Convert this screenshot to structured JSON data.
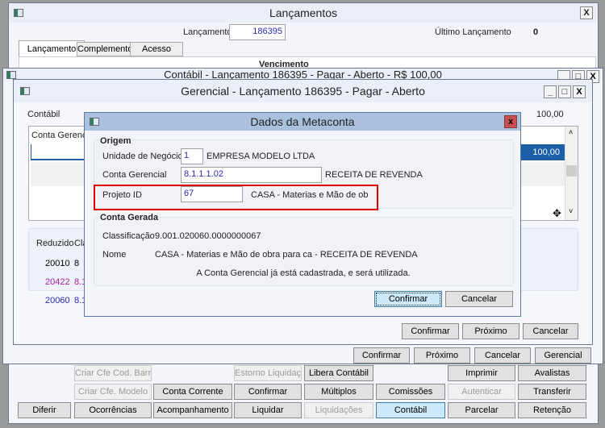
{
  "main": {
    "title": "Lançamentos",
    "lancamento_label": "Lançamento",
    "lancamento_value": "186395",
    "ultimo_label": "Último Lançamento",
    "ultimo_value": "0",
    "tabs": [
      {
        "label": "Lançamento"
      },
      {
        "label": "Complemento"
      },
      {
        "label": "Acesso"
      }
    ],
    "vencimento": "Vencimento",
    "buttons": [
      {
        "label": "Criar Cfe Cod. Barras",
        "disabled": true
      },
      {
        "label": "Estorno Liquidação",
        "disabled": true
      },
      {
        "label": "Libera Contábil"
      },
      {
        "label": "Imprimir"
      },
      {
        "label": "Avalistas"
      },
      {
        "label": "Criar Cfe. Modelo",
        "disabled": true
      },
      {
        "label": "Conta Corrente"
      },
      {
        "label": "Confirmar"
      },
      {
        "label": "Múltiplos"
      },
      {
        "label": "Comissões"
      },
      {
        "label": "Autenticar",
        "disabled": true
      },
      {
        "label": "Transferir"
      },
      {
        "label": "Diferir"
      },
      {
        "label": "Ocorrências"
      },
      {
        "label": "Acompanhamento"
      },
      {
        "label": "Liquidar"
      },
      {
        "label": "Liquidações",
        "disabled": true
      },
      {
        "label": "Contábil",
        "focused": true
      },
      {
        "label": "Parcelar"
      },
      {
        "label": "Retenção"
      }
    ]
  },
  "contabil_window": {
    "title": "Contábil - Lançamento 186395 - Pagar - Aberto - R$ 100,00",
    "buttons": [
      "Confirmar",
      "Próximo",
      "Cancelar",
      "Gerencial"
    ]
  },
  "gerencial_window": {
    "title": "Gerencial -  Lançamento 186395 - Pagar - Aberto",
    "contabil_label": "Contábil",
    "contabil_value": "100,00",
    "grid_header": "Conta Gerencia",
    "grid_row_value": "100,00",
    "lower_headers": [
      "Reduzido",
      "Cla"
    ],
    "lower_rows": [
      {
        "reduzido": "20010",
        "cla": "8",
        "color": "#000000"
      },
      {
        "reduzido": "20422",
        "cla": "8.1",
        "color": "#a0209a"
      },
      {
        "reduzido": "20060",
        "cla": "8.1",
        "color": "#2b2bb0"
      }
    ],
    "buttons": {
      "confirmar": "Confirmar",
      "proximo": "Próximo",
      "cancelar": "Cancelar"
    }
  },
  "dialog": {
    "title": "Dados da Metaconta",
    "origem": {
      "title": "Origem",
      "unidade_label": "Unidade de Negócio",
      "unidade_value": "1",
      "unidade_name": "EMPRESA MODELO LTDA",
      "conta_label": "Conta Gerencial",
      "conta_value": "8.1.1.1.02",
      "conta_name": "RECEITA DE REVENDA",
      "projeto_label": "Projeto ID",
      "projeto_value": "67",
      "projeto_name": "CASA - Materias e Mão de ob"
    },
    "gerada": {
      "title": "Conta Gerada",
      "classificacao_label": "Classificação",
      "classificacao_value": "9.001.020060.0000000067",
      "nome_label": "Nome",
      "nome_value": "CASA - Materias e Mão de obra para ca - RECEITA DE REVENDA",
      "message": "A Conta Gerencial já está cadastrada, e será utilizada."
    },
    "confirm": "Confirmar",
    "cancel": "Cancelar",
    "highlight_color": "#e00000"
  }
}
